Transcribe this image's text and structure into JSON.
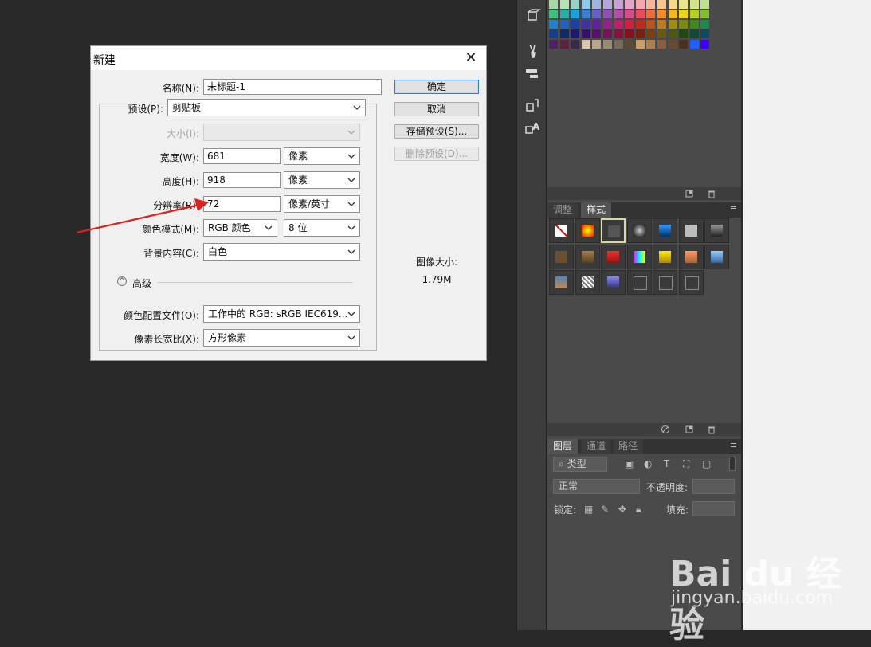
{
  "dialog": {
    "title": "新建",
    "close_symbol": "✕",
    "fields": {
      "name": {
        "label": "名称(N):",
        "value": "未标题-1"
      },
      "preset": {
        "label": "预设(P):",
        "value": "剪贴板"
      },
      "size": {
        "label": "大小(I):",
        "value": ""
      },
      "width": {
        "label": "宽度(W):",
        "value": "681",
        "unit": "像素"
      },
      "height": {
        "label": "高度(H):",
        "value": "918",
        "unit": "像素"
      },
      "resolution": {
        "label": "分辨率(R):",
        "value": "72",
        "unit": "像素/英寸"
      },
      "color_mode": {
        "label": "颜色模式(M):",
        "value": "RGB 颜色",
        "depth": "8 位"
      },
      "background": {
        "label": "背景内容(C):",
        "value": "白色"
      },
      "color_profile": {
        "label": "颜色配置文件(O):",
        "value": "工作中的 RGB: sRGB IEC619..."
      },
      "pixel_aspect": {
        "label": "像素长宽比(X):",
        "value": "方形像素"
      }
    },
    "advanced_label": "高级",
    "advanced_icon": "chevron-up-circle-icon",
    "buttons": {
      "ok": "确定",
      "cancel": "取消",
      "save_preset": "存储预设(S)...",
      "delete_preset": "删除预设(D)..."
    },
    "image_size": {
      "label": "图像大小:",
      "value": "1.79M"
    }
  },
  "panels": {
    "styles_tabs": [
      "调整",
      "样式"
    ],
    "layers_tabs": [
      "图层",
      "通道",
      "路径"
    ],
    "layers": {
      "filter_label": "类型",
      "blend_mode": "正常",
      "opacity_label": "不透明度:",
      "lock_label": "锁定:",
      "fill_label": "填充:"
    }
  },
  "watermark": {
    "logo": "Bai du 经验",
    "url": "jingyan.baidu.com"
  },
  "colors": {
    "arrow": "#e0201c",
    "ok_button_border": "#2f7bd5",
    "workspace": "#282828",
    "panel": "#4a4a4a"
  }
}
